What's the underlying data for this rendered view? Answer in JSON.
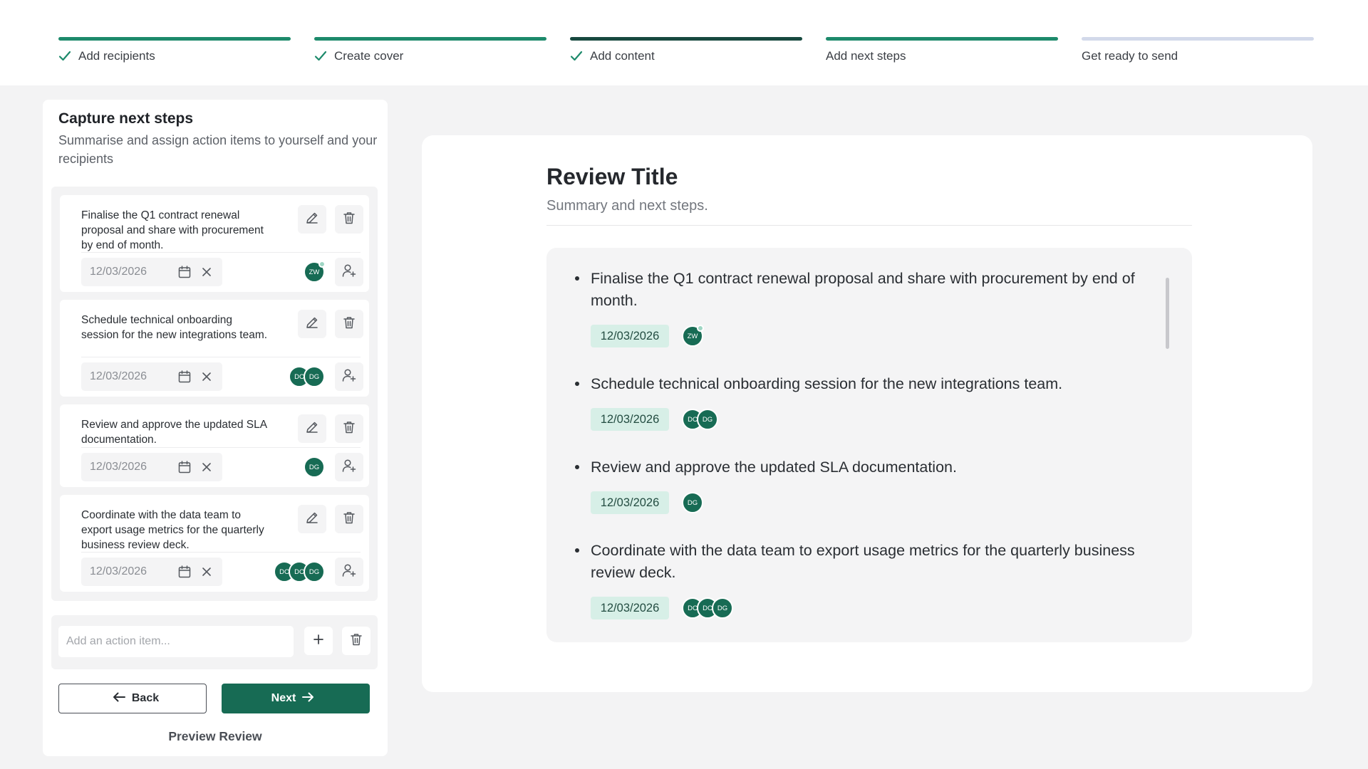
{
  "stepper": {
    "steps": [
      {
        "label": "Add recipients",
        "state": "done"
      },
      {
        "label": "Create cover",
        "state": "done"
      },
      {
        "label": "Add content",
        "state": "current"
      },
      {
        "label": "Add next steps",
        "state": "active"
      },
      {
        "label": "Get ready to send",
        "state": "pending"
      }
    ]
  },
  "panel": {
    "title": "Capture next steps",
    "subtitle": "Summarise and assign action items to yourself and your recipients"
  },
  "items": [
    {
      "text": "Finalise the Q1 contract renewal proposal and share with procurement by end of month.",
      "date": "12/03/2026",
      "assignees": [
        "ZW"
      ]
    },
    {
      "text": "Schedule technical onboarding session for the new integrations team.",
      "date": "12/03/2026",
      "assignees": [
        "DC",
        "DG"
      ]
    },
    {
      "text": "Review and approve the updated SLA documentation.",
      "date": "12/03/2026",
      "assignees": [
        "DG"
      ]
    },
    {
      "text": "Coordinate with the data team to export usage metrics for the quarterly business review deck.",
      "date": "12/03/2026",
      "assignees": [
        "DC",
        "DC",
        "DG"
      ]
    }
  ],
  "add_item": {
    "placeholder": "Add an action item..."
  },
  "buttons": {
    "back": "Back",
    "next": "Next",
    "preview": "Preview Review"
  },
  "preview": {
    "title": "Review Title",
    "subtitle": "Summary and next steps."
  },
  "colors": {
    "accent": "#176b54",
    "progress_done": "#1d8a6b",
    "progress_current": "#17493f",
    "progress_pending": "#d2d9ea",
    "chip_bg": "#d7efe7"
  },
  "icons": {
    "step_done": "check-icon",
    "edit": "pencil-icon",
    "delete": "trash-icon",
    "calendar": "calendar-icon",
    "clear": "x-icon",
    "assign": "user-plus-icon",
    "add": "plus-icon"
  }
}
